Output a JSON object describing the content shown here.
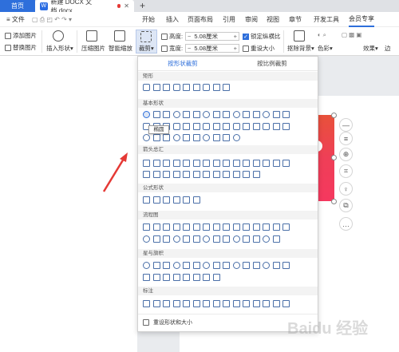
{
  "tabs": {
    "home": "首页",
    "doc_badge": "W",
    "doc_title": "新建 DOCX 文档.docx",
    "plus": "+"
  },
  "menu": {
    "file": "≡ 文件",
    "items": [
      "开始",
      "插入",
      "页面布局",
      "引用",
      "审阅",
      "视图",
      "章节",
      "开发工具",
      "会员专享"
    ]
  },
  "toolbar": {
    "add_picture": "添加图片",
    "replace_picture": "替换图片",
    "insert_shape": "插入形状",
    "compress_picture": "压缩图片",
    "smart_scale": "智能缩放",
    "crop": "裁剪",
    "height_label": "高度:",
    "height_value": "5.08厘米",
    "width_label": "宽度:",
    "width_value": "5.08厘米",
    "lock_ratio": "锁定纵横比",
    "reset_size": "重设大小",
    "remove_bg": "抠除背景",
    "color": "色彩",
    "effect": "效果",
    "edge": "边"
  },
  "dropdown": {
    "tab_shape": "按形状裁剪",
    "tab_ratio": "按比例裁剪",
    "categories": [
      "矩形",
      "基本形状",
      "箭头总汇",
      "公式形状",
      "流程图",
      "星与旗帜",
      "标注"
    ],
    "tooltip": "椭圆",
    "reset": "重设形状和大小"
  },
  "side_tools": [
    "—",
    "≡",
    "⊕",
    "⌗",
    "♀",
    "⧉",
    "…"
  ],
  "colors": {
    "accent": "#2e6fdb",
    "shape_stroke": "#4a6fa8",
    "arrow": "#e53935"
  }
}
